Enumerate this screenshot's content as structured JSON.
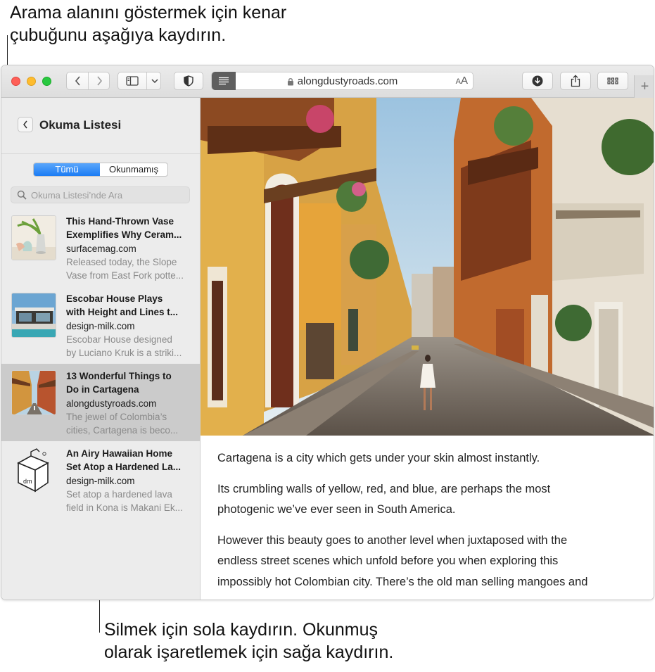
{
  "callouts": {
    "top_line1": "Arama alanını göstermek için kenar",
    "top_line2": "çubuğunu aşağıya kaydırın.",
    "bottom_line1": "Silmek için sola kaydırın. Okunmuş",
    "bottom_line2": "olarak işaretlemek için sağa kaydırın."
  },
  "toolbar": {
    "url": "alongdustyroads.com",
    "text_size_small": "A",
    "text_size_large": "A",
    "new_tab": "+"
  },
  "sidebar": {
    "title": "Okuma Listesi",
    "filter_all": "Tümü",
    "filter_unread": "Okunmamış",
    "search_placeholder": "Okuma Listesi’nde Ara",
    "items": [
      {
        "title_line1": "This Hand-Thrown Vase",
        "title_line2": "Exemplifies Why Ceram...",
        "site": "surfacemag.com",
        "desc_line1": "Released today, the Slope",
        "desc_line2": "Vase from East Fork potte..."
      },
      {
        "title_line1": "Escobar House Plays",
        "title_line2": "with Height and Lines t...",
        "site": "design-milk.com",
        "desc_line1": "Escobar House designed",
        "desc_line2": "by Luciano Kruk is a striki..."
      },
      {
        "title_line1": "13 Wonderful Things to",
        "title_line2": "Do in Cartagena",
        "site": "alongdustyroads.com",
        "desc_line1": "The jewel of Colombia’s",
        "desc_line2": "cities, Cartagena is beco..."
      },
      {
        "title_line1": "An Airy Hawaiian Home",
        "title_line2": "Set Atop a Hardened La...",
        "site": "design-milk.com",
        "desc_line1": "Set atop a hardened lava",
        "desc_line2": "field in Kona is Makani Ek..."
      }
    ],
    "logo_text": "dm"
  },
  "article": {
    "p1": "Cartagena is a city which gets under your skin almost instantly.",
    "p2_line1": "Its crumbling walls of yellow, red, and blue, are perhaps the most",
    "p2_line2": "photogenic we’ve ever seen in South America.",
    "p3_line1": "However this beauty goes to another level when juxtaposed with the",
    "p3_line2": "endless street scenes which unfold before you when exploring this",
    "p3_line3": "impossibly hot Colombian city. There’s the old man selling mangoes and"
  },
  "colors": {
    "accent": "#1b7cf4",
    "selected_row": "#cbcbcb",
    "sidebar_bg": "#ececec"
  }
}
